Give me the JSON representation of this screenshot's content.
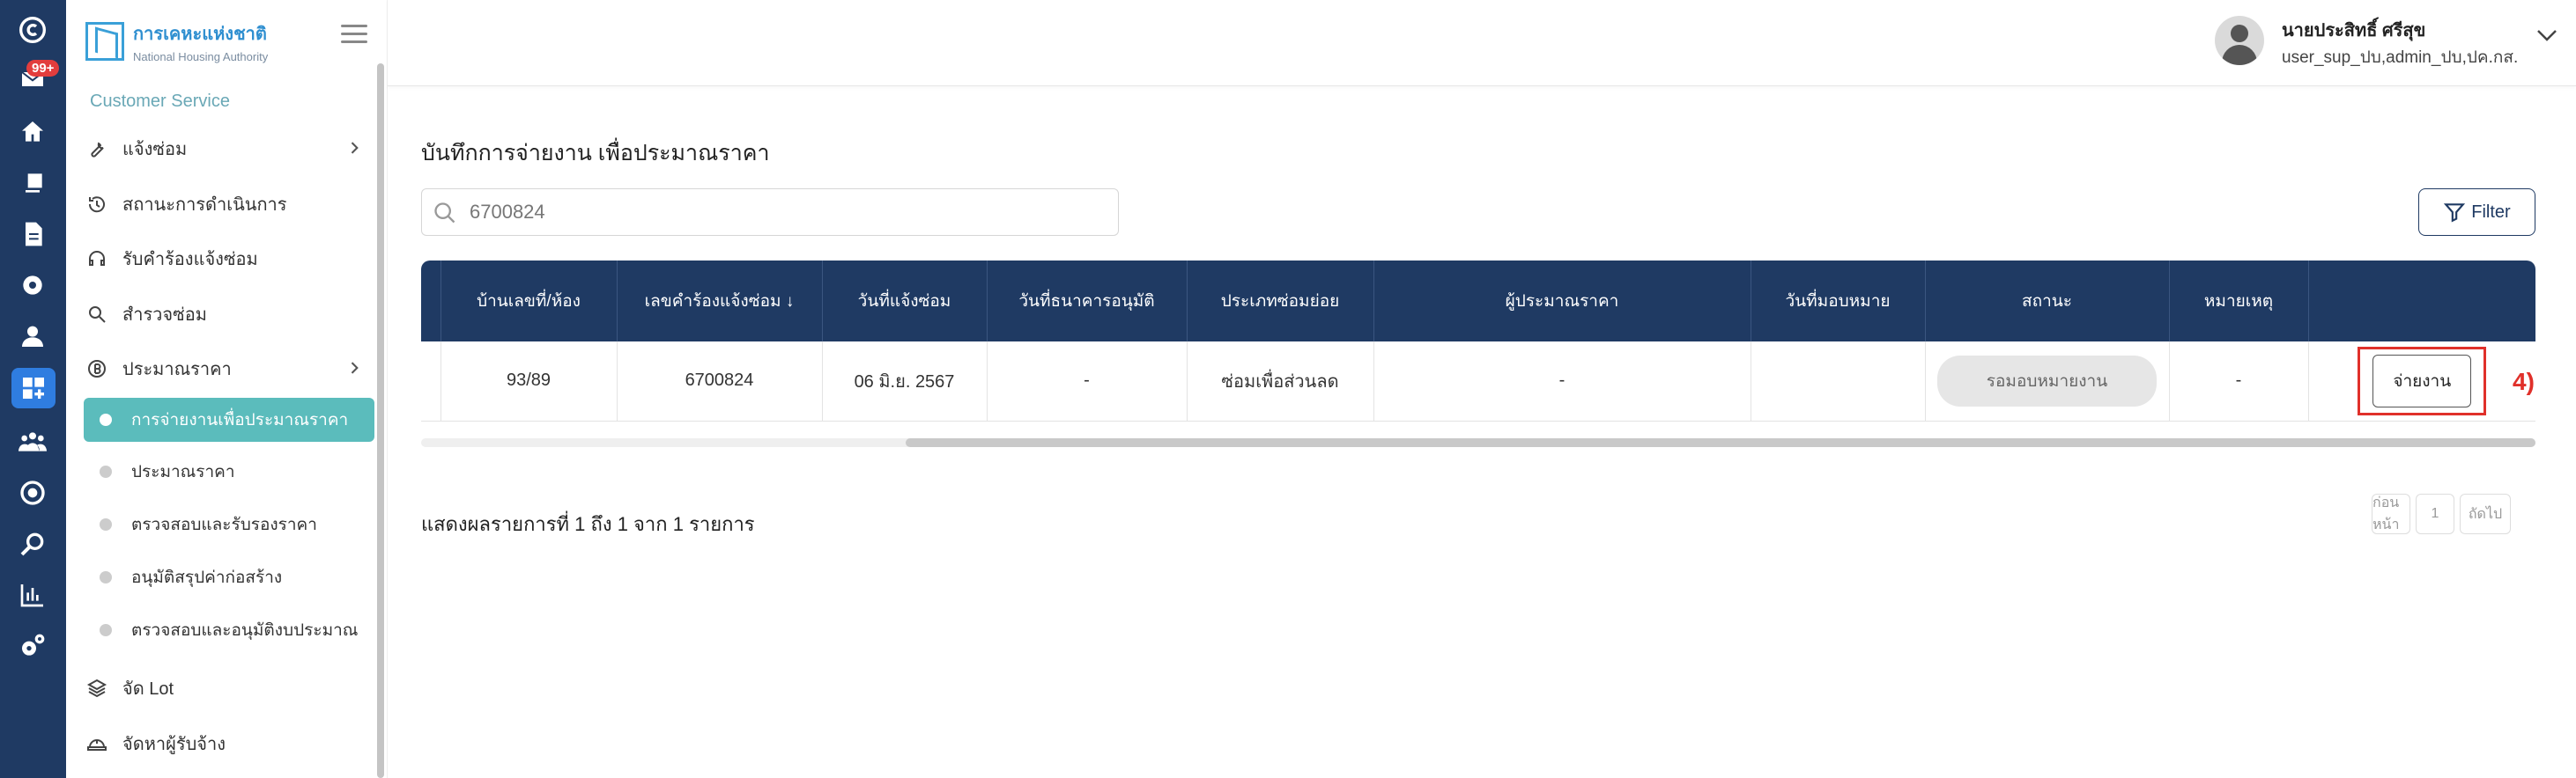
{
  "rail": {
    "badge": "99+",
    "icons": [
      "logo-c-icon",
      "mail-icon",
      "home-icon",
      "layers-icon",
      "document-icon",
      "gear-cog-icon",
      "user-icon",
      "dashboard-add-icon",
      "group-icon",
      "settings-badge-icon",
      "search-icon",
      "chart-icon",
      "settings-icon"
    ]
  },
  "sidebar": {
    "logo_th": "การเคหะแห่งชาติ",
    "logo_en": "National Housing Authority",
    "section_title": "Customer Service",
    "items": [
      {
        "label": "แจ้งซ่อม",
        "icon": "wrench-icon",
        "has_children": true
      },
      {
        "label": "สถานะการดำเนินการ",
        "icon": "history-icon"
      },
      {
        "label": "รับคำร้องแจ้งซ่อม",
        "icon": "headset-icon"
      },
      {
        "label": "สำรวจซ่อม",
        "icon": "search-icon"
      },
      {
        "label": "ประมาณราคา",
        "icon": "baht-icon",
        "has_children": true
      }
    ],
    "subitems": [
      {
        "label": "การจ่ายงานเพื่อประมาณราคา",
        "active": true
      },
      {
        "label": "ประมาณราคา"
      },
      {
        "label": "ตรวจสอบและรับรองราคา"
      },
      {
        "label": "อนุมัติสรุปค่าก่อสร้าง"
      },
      {
        "label": "ตรวจสอบและอนุมัติงบประมาณ"
      }
    ],
    "bottom_items": [
      {
        "label": "จัด Lot",
        "icon": "stack-icon"
      },
      {
        "label": "จัดหาผู้รับจ้าง",
        "icon": "helmet-icon"
      }
    ]
  },
  "header": {
    "user_name": "นายประสิทธิ์ ศรีสุข",
    "user_role": "user_sup_ปบ,admin_ปบ,ปค.กส."
  },
  "main": {
    "title": "บันทึกการจ่ายงาน เพื่อประมาณราคา",
    "search_value": "6700824",
    "filter_label": "Filter",
    "columns": [
      "บ้านเลขที่/ห้อง",
      "เลขคำร้องแจ้งซ่อม ↓",
      "วันที่แจ้งซ่อม",
      "วันที่ธนาคารอนุมัติ",
      "ประเภทซ่อมย่อย",
      "ผู้ประมาณราคา",
      "วันที่มอบหมาย",
      "สถานะ",
      "หมายเหตุ",
      ""
    ],
    "rows": [
      {
        "house_no": "93/89",
        "request_no": "6700824",
        "request_date": "06 มิ.ย. 2567",
        "bank_approval_date": "-",
        "repair_type": "ซ่อมเพื่อส่วนลด",
        "estimator": "-",
        "assigned_date": "",
        "status": "รอมอบหมายงาน",
        "note": "-",
        "action": "จ่ายงาน"
      }
    ],
    "annotation": "4)",
    "summary": "แสดงผลรายการที่ 1 ถึง 1 จาก 1 รายการ",
    "pager": {
      "prev": "ก่อนหน้า",
      "page": "1",
      "next": "ถัดไป"
    }
  },
  "colors": {
    "navy": "#1f3a63",
    "teal": "#5bbcbc",
    "rail_active": "#2f7de0",
    "annotation_red": "#e0302a"
  }
}
